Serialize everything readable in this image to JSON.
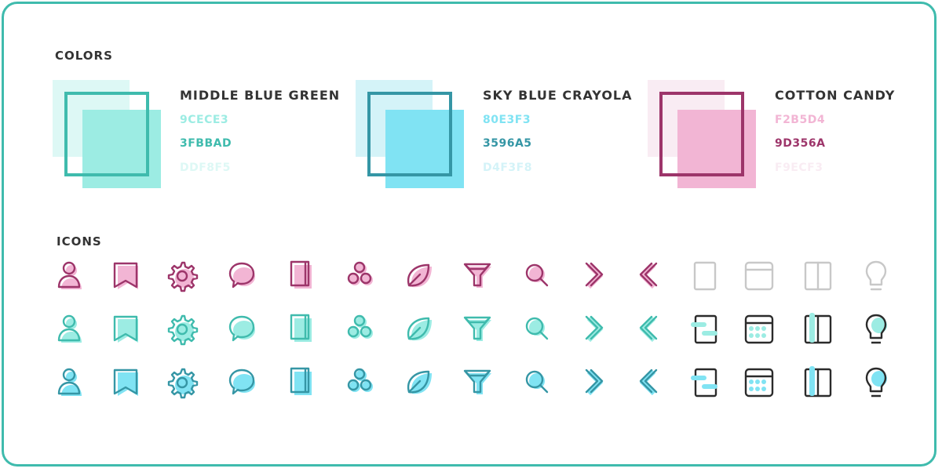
{
  "colors_title": "COLORS",
  "icons_title": "ICONS",
  "palette": [
    {
      "name": "MIDDLE BLUE GREEN",
      "hex1": "9CECE3",
      "hex2": "3FBBAD",
      "hex3": "DDF8F5",
      "c1": "#9CECE3",
      "c2": "#3FBBAD",
      "c3": "#DDF8F5"
    },
    {
      "name": "SKY BLUE CRAYOLA",
      "hex1": "80E3F3",
      "hex2": "3596A5",
      "hex3": "D4F3F8",
      "c1": "#80E3F3",
      "c2": "#3596A5",
      "c3": "#D4F3F8"
    },
    {
      "name": "COTTON CANDY",
      "hex1": "F2B5D4",
      "hex2": "9D356A",
      "hex3": "F9ECF3",
      "c1": "#F2B5D4",
      "c2": "#9D356A",
      "c3": "#F9ECF3"
    }
  ],
  "icon_names": [
    "user-icon",
    "bookmark-icon",
    "gear-icon",
    "chat-bubble-icon",
    "document-icon",
    "circles-icon",
    "leaf-icon",
    "funnel-icon",
    "search-icon",
    "chevron-right-icon",
    "chevron-left-icon",
    "tablet-icon",
    "window-icon",
    "columns-icon",
    "lightbulb-icon"
  ],
  "icon_rows": [
    {
      "stroke": "#9D356A",
      "fill": "#F2B5D4",
      "gray_last": true
    },
    {
      "stroke": "#3FBBAD",
      "fill": "#9CECE3",
      "gray_last": false
    },
    {
      "stroke": "#3596A5",
      "fill": "#80E3F3",
      "gray_last": false
    }
  ],
  "colors": {
    "frame": "#3FBBAD",
    "gray": "#C8C8C8",
    "dark": "#2B2B2B"
  }
}
